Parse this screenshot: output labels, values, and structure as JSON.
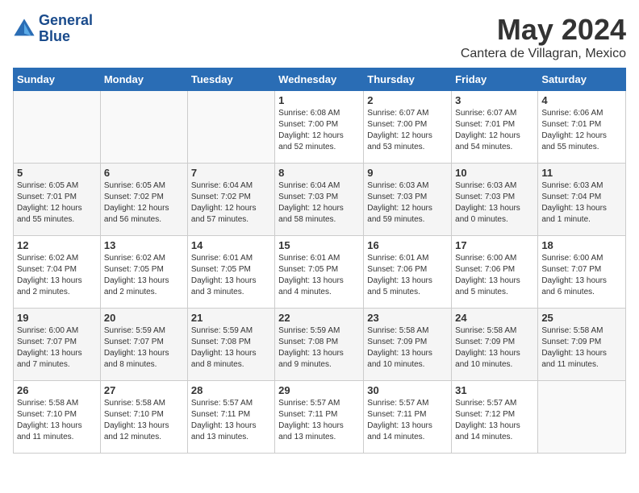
{
  "header": {
    "logo_line1": "General",
    "logo_line2": "Blue",
    "month": "May 2024",
    "location": "Cantera de Villagran, Mexico"
  },
  "weekdays": [
    "Sunday",
    "Monday",
    "Tuesday",
    "Wednesday",
    "Thursday",
    "Friday",
    "Saturday"
  ],
  "weeks": [
    [
      {
        "day": "",
        "info": ""
      },
      {
        "day": "",
        "info": ""
      },
      {
        "day": "",
        "info": ""
      },
      {
        "day": "1",
        "info": "Sunrise: 6:08 AM\nSunset: 7:00 PM\nDaylight: 12 hours\nand 52 minutes."
      },
      {
        "day": "2",
        "info": "Sunrise: 6:07 AM\nSunset: 7:00 PM\nDaylight: 12 hours\nand 53 minutes."
      },
      {
        "day": "3",
        "info": "Sunrise: 6:07 AM\nSunset: 7:01 PM\nDaylight: 12 hours\nand 54 minutes."
      },
      {
        "day": "4",
        "info": "Sunrise: 6:06 AM\nSunset: 7:01 PM\nDaylight: 12 hours\nand 55 minutes."
      }
    ],
    [
      {
        "day": "5",
        "info": "Sunrise: 6:05 AM\nSunset: 7:01 PM\nDaylight: 12 hours\nand 55 minutes."
      },
      {
        "day": "6",
        "info": "Sunrise: 6:05 AM\nSunset: 7:02 PM\nDaylight: 12 hours\nand 56 minutes."
      },
      {
        "day": "7",
        "info": "Sunrise: 6:04 AM\nSunset: 7:02 PM\nDaylight: 12 hours\nand 57 minutes."
      },
      {
        "day": "8",
        "info": "Sunrise: 6:04 AM\nSunset: 7:03 PM\nDaylight: 12 hours\nand 58 minutes."
      },
      {
        "day": "9",
        "info": "Sunrise: 6:03 AM\nSunset: 7:03 PM\nDaylight: 12 hours\nand 59 minutes."
      },
      {
        "day": "10",
        "info": "Sunrise: 6:03 AM\nSunset: 7:03 PM\nDaylight: 13 hours\nand 0 minutes."
      },
      {
        "day": "11",
        "info": "Sunrise: 6:03 AM\nSunset: 7:04 PM\nDaylight: 13 hours\nand 1 minute."
      }
    ],
    [
      {
        "day": "12",
        "info": "Sunrise: 6:02 AM\nSunset: 7:04 PM\nDaylight: 13 hours\nand 2 minutes."
      },
      {
        "day": "13",
        "info": "Sunrise: 6:02 AM\nSunset: 7:05 PM\nDaylight: 13 hours\nand 2 minutes."
      },
      {
        "day": "14",
        "info": "Sunrise: 6:01 AM\nSunset: 7:05 PM\nDaylight: 13 hours\nand 3 minutes."
      },
      {
        "day": "15",
        "info": "Sunrise: 6:01 AM\nSunset: 7:05 PM\nDaylight: 13 hours\nand 4 minutes."
      },
      {
        "day": "16",
        "info": "Sunrise: 6:01 AM\nSunset: 7:06 PM\nDaylight: 13 hours\nand 5 minutes."
      },
      {
        "day": "17",
        "info": "Sunrise: 6:00 AM\nSunset: 7:06 PM\nDaylight: 13 hours\nand 5 minutes."
      },
      {
        "day": "18",
        "info": "Sunrise: 6:00 AM\nSunset: 7:07 PM\nDaylight: 13 hours\nand 6 minutes."
      }
    ],
    [
      {
        "day": "19",
        "info": "Sunrise: 6:00 AM\nSunset: 7:07 PM\nDaylight: 13 hours\nand 7 minutes."
      },
      {
        "day": "20",
        "info": "Sunrise: 5:59 AM\nSunset: 7:07 PM\nDaylight: 13 hours\nand 8 minutes."
      },
      {
        "day": "21",
        "info": "Sunrise: 5:59 AM\nSunset: 7:08 PM\nDaylight: 13 hours\nand 8 minutes."
      },
      {
        "day": "22",
        "info": "Sunrise: 5:59 AM\nSunset: 7:08 PM\nDaylight: 13 hours\nand 9 minutes."
      },
      {
        "day": "23",
        "info": "Sunrise: 5:58 AM\nSunset: 7:09 PM\nDaylight: 13 hours\nand 10 minutes."
      },
      {
        "day": "24",
        "info": "Sunrise: 5:58 AM\nSunset: 7:09 PM\nDaylight: 13 hours\nand 10 minutes."
      },
      {
        "day": "25",
        "info": "Sunrise: 5:58 AM\nSunset: 7:09 PM\nDaylight: 13 hours\nand 11 minutes."
      }
    ],
    [
      {
        "day": "26",
        "info": "Sunrise: 5:58 AM\nSunset: 7:10 PM\nDaylight: 13 hours\nand 11 minutes."
      },
      {
        "day": "27",
        "info": "Sunrise: 5:58 AM\nSunset: 7:10 PM\nDaylight: 13 hours\nand 12 minutes."
      },
      {
        "day": "28",
        "info": "Sunrise: 5:57 AM\nSunset: 7:11 PM\nDaylight: 13 hours\nand 13 minutes."
      },
      {
        "day": "29",
        "info": "Sunrise: 5:57 AM\nSunset: 7:11 PM\nDaylight: 13 hours\nand 13 minutes."
      },
      {
        "day": "30",
        "info": "Sunrise: 5:57 AM\nSunset: 7:11 PM\nDaylight: 13 hours\nand 14 minutes."
      },
      {
        "day": "31",
        "info": "Sunrise: 5:57 AM\nSunset: 7:12 PM\nDaylight: 13 hours\nand 14 minutes."
      },
      {
        "day": "",
        "info": ""
      }
    ]
  ]
}
